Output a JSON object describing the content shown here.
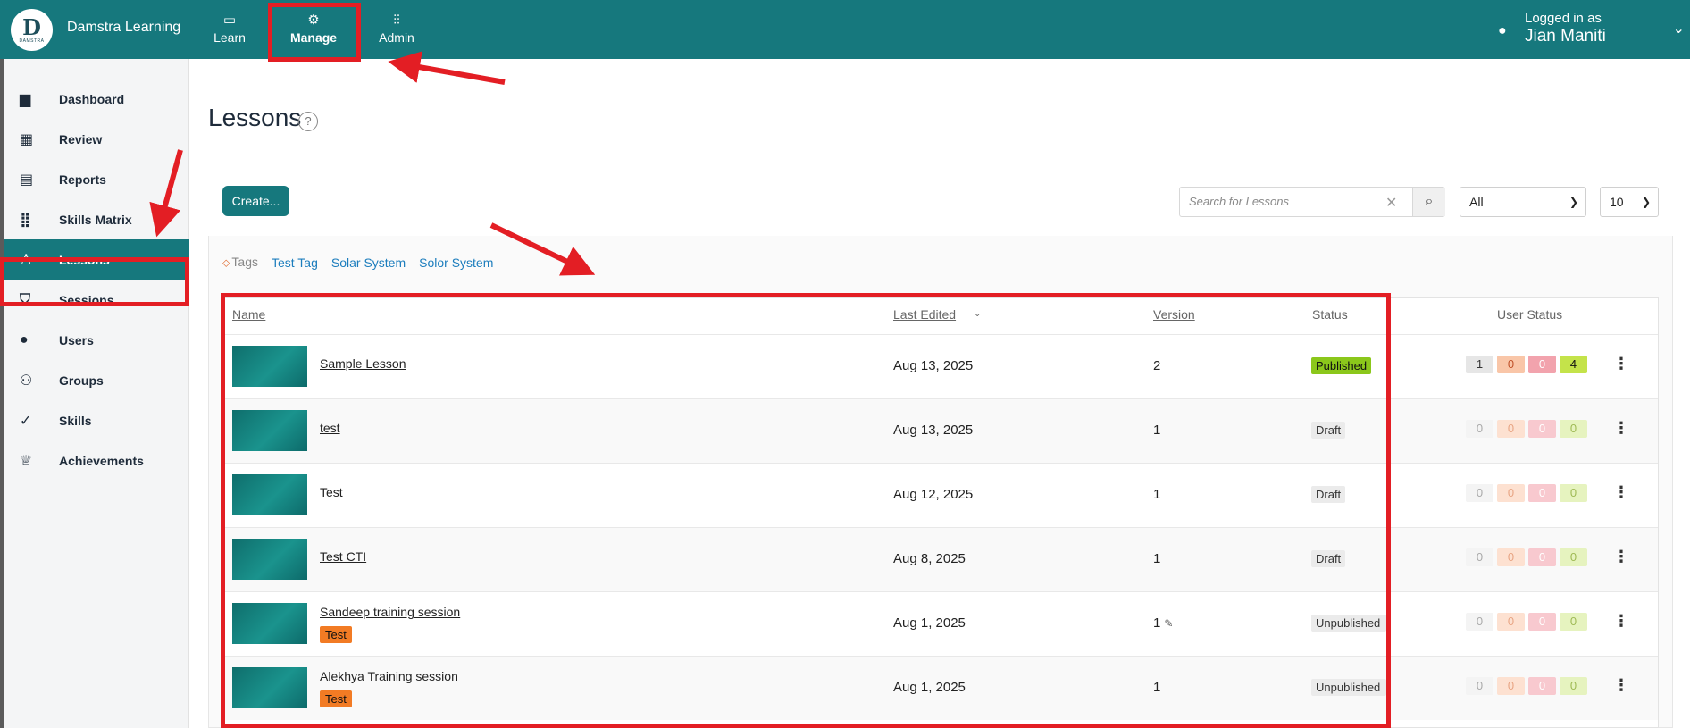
{
  "header": {
    "logo_letter": "D",
    "logo_word": "DAMSTRA",
    "brand": "Damstra Learning",
    "nav": [
      {
        "label": "Learn",
        "icon": "monitor-icon"
      },
      {
        "label": "Manage",
        "icon": "gear-icon"
      },
      {
        "label": "Admin",
        "icon": "sliders-icon"
      }
    ],
    "user": {
      "logged_in_label": "Logged in as",
      "name": "Jian Maniti"
    }
  },
  "sidebar": {
    "items": [
      {
        "label": "Dashboard",
        "icon": "bar-chart-icon"
      },
      {
        "label": "Review",
        "icon": "calendar-icon"
      },
      {
        "label": "Reports",
        "icon": "clipboard-icon"
      },
      {
        "label": "Skills Matrix",
        "icon": "grid-icon"
      },
      {
        "label": "Lessons",
        "icon": "lesson-icon",
        "active": true
      },
      {
        "label": "Sessions",
        "icon": "presentation-icon"
      },
      {
        "label": "Users",
        "icon": "user-icon"
      },
      {
        "label": "Groups",
        "icon": "users-icon"
      },
      {
        "label": "Skills",
        "icon": "check-circle-icon"
      },
      {
        "label": "Achievements",
        "icon": "trophy-icon"
      }
    ]
  },
  "main": {
    "title": "Lessons",
    "help": "?",
    "create_label": "Create...",
    "search_placeholder": "Search for Lessons",
    "status_filter": "All",
    "page_size": "10",
    "tags_label": "Tags",
    "tags": [
      "Test Tag",
      "Solar System",
      "Solor System"
    ]
  },
  "table": {
    "headers": {
      "name": "Name",
      "last_edited": "Last Edited",
      "version": "Version",
      "status": "Status",
      "user_status": "User Status"
    },
    "rows": [
      {
        "name": "Sample Lesson",
        "tag": "",
        "edited": "Aug 13, 2025",
        "version": "2",
        "status": "Published",
        "counts": [
          "1",
          "0",
          "0",
          "4"
        ]
      },
      {
        "name": "test",
        "tag": "",
        "edited": "Aug 13, 2025",
        "version": "1",
        "status": "Draft",
        "counts": [
          "0",
          "0",
          "0",
          "0"
        ]
      },
      {
        "name": "Test",
        "tag": "",
        "edited": "Aug 12, 2025",
        "version": "1",
        "status": "Draft",
        "counts": [
          "0",
          "0",
          "0",
          "0"
        ]
      },
      {
        "name": "Test CTI",
        "tag": "",
        "edited": "Aug 8, 2025",
        "version": "1",
        "status": "Draft",
        "counts": [
          "0",
          "0",
          "0",
          "0"
        ]
      },
      {
        "name": "Sandeep training session",
        "tag": "Test",
        "edited": "Aug 1, 2025",
        "version": "1",
        "status": "Unpublished",
        "counts": [
          "0",
          "0",
          "0",
          "0"
        ]
      },
      {
        "name": "Alekhya Training session",
        "tag": "Test",
        "edited": "Aug 1, 2025",
        "version": "1",
        "status": "Unpublished",
        "counts": [
          "0",
          "0",
          "0",
          "0"
        ]
      }
    ]
  },
  "colors": {
    "accent": "#16787d",
    "highlight": "#e31e24",
    "published": "#8bc71b",
    "tag": "#f27b24"
  }
}
